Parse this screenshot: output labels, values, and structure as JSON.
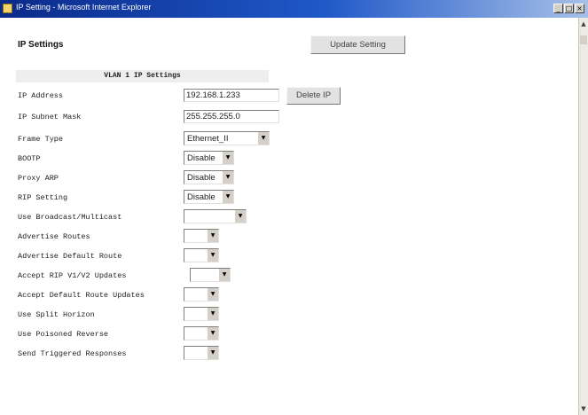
{
  "window": {
    "title": "IP Setting - Microsoft Internet Explorer"
  },
  "page": {
    "title": "IP Settings",
    "update_button": "Update Setting",
    "delete_button": "Delete IP"
  },
  "section": {
    "header": "VLAN 1 IP Settings"
  },
  "fields": {
    "ip_address": {
      "label": "IP Address",
      "value": "192.168.1.233"
    },
    "subnet_mask": {
      "label": "IP Subnet Mask",
      "value": "255.255.255.0"
    },
    "frame_type": {
      "label": "Frame Type",
      "value": "Ethernet_II"
    },
    "bootp": {
      "label": "BOOTP",
      "value": "Disable"
    },
    "proxy_arp": {
      "label": "Proxy ARP",
      "value": "Disable"
    },
    "rip_setting": {
      "label": "RIP Setting",
      "value": "Disable"
    },
    "broadcast": {
      "label": "Use Broadcast/Multicast",
      "value": ""
    },
    "advertise_routes": {
      "label": "Advertise Routes",
      "value": ""
    },
    "advertise_default_route": {
      "label": "Advertise Default Route",
      "value": ""
    },
    "accept_rip": {
      "label": "Accept RIP V1/V2 Updates",
      "value": ""
    },
    "accept_default_route": {
      "label": "Accept Default Route Updates",
      "value": ""
    },
    "split_horizon": {
      "label": "Use Split Horizon",
      "value": ""
    },
    "poisoned_reverse": {
      "label": "Use Poisoned Reverse",
      "value": ""
    },
    "triggered_responses": {
      "label": "Send Triggered Responses",
      "value": ""
    }
  }
}
